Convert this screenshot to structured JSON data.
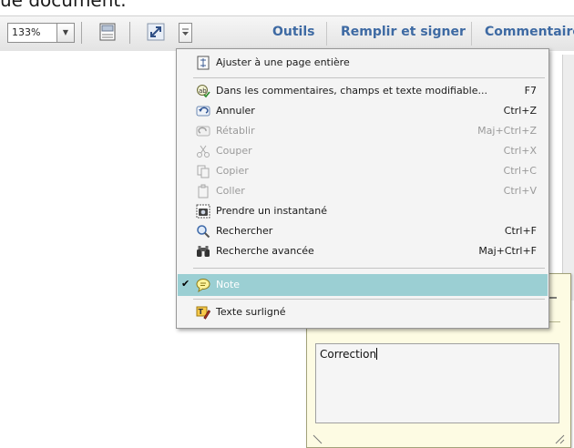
{
  "top_snippet": "ue document.",
  "toolbar": {
    "zoom_value": "133%",
    "tabs": [
      {
        "label": "Outils"
      },
      {
        "label": "Remplir et signer"
      },
      {
        "label": "Commentaire"
      }
    ]
  },
  "context_menu": {
    "items": [
      {
        "label": "Ajuster à une page entière",
        "shortcut": "",
        "enabled": true,
        "icon": "fit-page-icon"
      },
      {
        "label": "Dans les commentaires, champs et texte modifiable...",
        "shortcut": "F7",
        "enabled": true,
        "icon": "spellcheck-icon"
      },
      {
        "label": "Annuler",
        "shortcut": "Ctrl+Z",
        "enabled": true,
        "icon": "undo-icon"
      },
      {
        "label": "Rétablir",
        "shortcut": "Maj+Ctrl+Z",
        "enabled": false,
        "icon": "redo-icon"
      },
      {
        "label": "Couper",
        "shortcut": "Ctrl+X",
        "enabled": false,
        "icon": "cut-icon"
      },
      {
        "label": "Copier",
        "shortcut": "Ctrl+C",
        "enabled": false,
        "icon": "copy-icon"
      },
      {
        "label": "Coller",
        "shortcut": "Ctrl+V",
        "enabled": false,
        "icon": "paste-icon"
      },
      {
        "label": "Prendre un instantané",
        "shortcut": "",
        "enabled": true,
        "icon": "camera-icon"
      },
      {
        "label": "Rechercher",
        "shortcut": "Ctrl+F",
        "enabled": true,
        "icon": "search-icon"
      },
      {
        "label": "Recherche avancée",
        "shortcut": "Maj+Ctrl+F",
        "enabled": true,
        "icon": "binoculars-icon"
      },
      {
        "label": "Note",
        "shortcut": "",
        "enabled": true,
        "checked": true,
        "selected": true,
        "icon": "note-icon"
      },
      {
        "label": "Texte surligné",
        "shortcut": "",
        "enabled": true,
        "icon": "highlight-icon"
      }
    ]
  },
  "note_popup": {
    "text": "Correction"
  },
  "colors": {
    "tab_text": "#3e6aa3",
    "menu_selected": "#9bcfd3",
    "note_background": "#fdfbe3"
  }
}
